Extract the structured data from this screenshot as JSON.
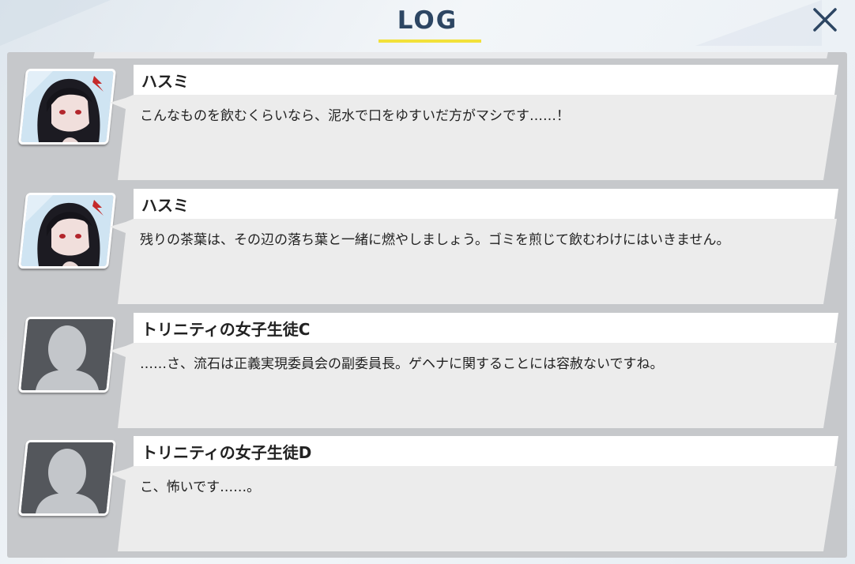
{
  "header": {
    "title": "LOG",
    "close_icon": "close-icon",
    "accent_color": "#f2e13a",
    "title_color": "#2d4663"
  },
  "log": {
    "entries": [
      {
        "speaker": "ハスミ",
        "text": "こんなものを飲むくらいなら、泥水で口をゆすいだ方がマシです……！",
        "avatar": "hasumi-portrait"
      },
      {
        "speaker": "ハスミ",
        "text": "残りの茶葉は、その辺の落ち葉と一緒に燃やしましょう。ゴミを煎じて飲むわけにはいきません。",
        "avatar": "hasumi-portrait"
      },
      {
        "speaker": "トリニティの女子生徒C",
        "text": "……さ、流石は正義実現委員会の副委員長。ゲヘナに関することには容赦ないですね。",
        "avatar": "default-silhouette"
      },
      {
        "speaker": "トリニティの女子生徒D",
        "text": "こ、怖いです……。",
        "avatar": "default-silhouette"
      }
    ]
  }
}
